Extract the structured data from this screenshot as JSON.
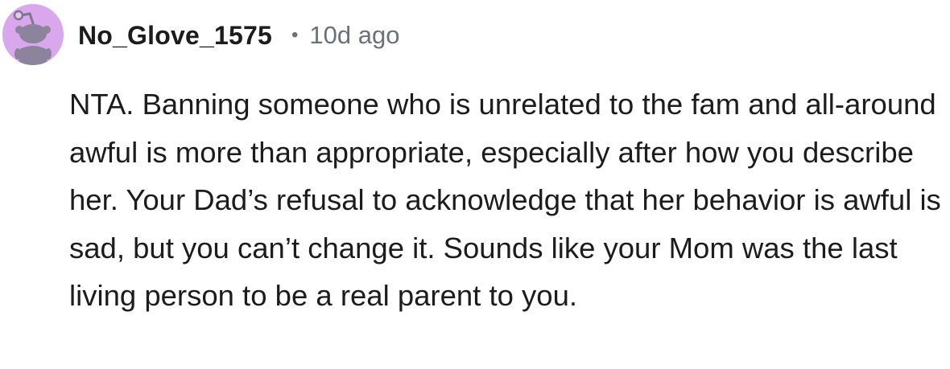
{
  "comment": {
    "avatar_icon": "snoo-avatar-icon",
    "avatar_color": "#d9a7ec",
    "username": "No_Glove_1575",
    "separator": "•",
    "timestamp": "10d ago",
    "body": "NTA. Banning someone who is unrelated to the fam and all-around awful is more than appropriate, especially after how you describe her. Your Dad’s refusal to acknowledge that her behavior is awful is sad, but you can’t change it. Sounds like your Mom was the last living person to be a real parent to you."
  }
}
